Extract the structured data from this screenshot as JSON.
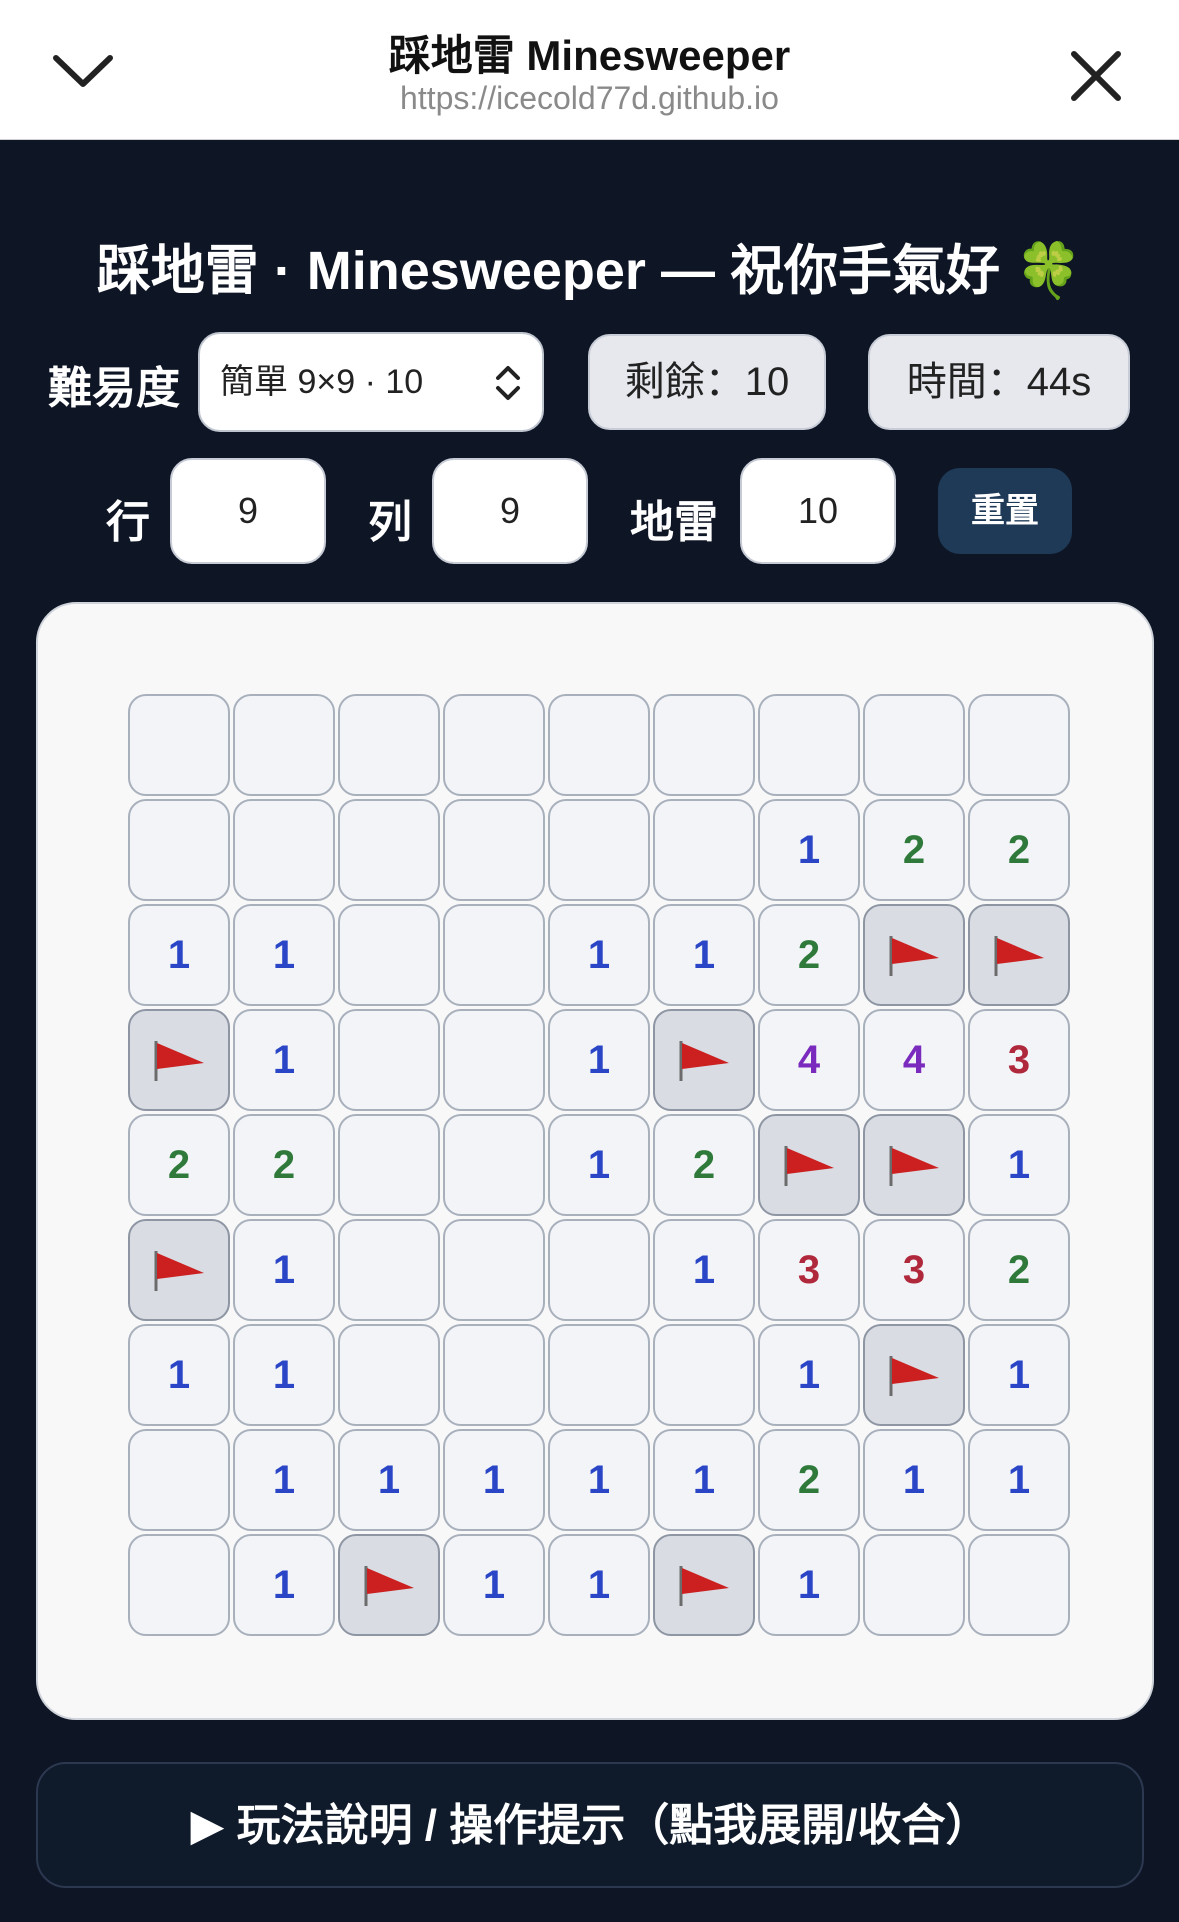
{
  "browser": {
    "title": "踩地雷 Minesweeper",
    "url": "https://icecold77d.github.io"
  },
  "game": {
    "title": "踩地雷 · Minesweeper — 祝你手氣好 🍀",
    "difficulty_label": "難易度",
    "difficulty_value": "簡單 9×9 · 10",
    "remaining": "剩餘：10",
    "time": "時間：44s",
    "rows_label": "行",
    "rows_value": "9",
    "cols_label": "列",
    "cols_value": "9",
    "mines_label": "地雷",
    "mines_value": "10",
    "reset_label": "重置",
    "help_label": "▶ 玩法說明 / 操作提示（點我展開/收合）"
  },
  "colors": {
    "1": "#2a46c7",
    "2": "#2f7a3a",
    "3": "#b0283c",
    "4": "#7a2bbd",
    "flag": "#cc1f1f"
  },
  "board": [
    [
      "",
      "",
      "",
      "",
      "",
      "",
      "",
      "",
      ""
    ],
    [
      "",
      "",
      "",
      "",
      "",
      "",
      "1",
      "2",
      "2"
    ],
    [
      "1",
      "1",
      "",
      "",
      "1",
      "1",
      "2",
      "F",
      "F"
    ],
    [
      "F",
      "1",
      "",
      "",
      "1",
      "F",
      "4",
      "4",
      "3"
    ],
    [
      "2",
      "2",
      "",
      "",
      "1",
      "2",
      "F",
      "F",
      "1"
    ],
    [
      "F",
      "1",
      "",
      "",
      "",
      "1",
      "3",
      "3",
      "2"
    ],
    [
      "1",
      "1",
      "",
      "",
      "",
      "",
      "1",
      "F",
      "1"
    ],
    [
      "",
      "1",
      "1",
      "1",
      "1",
      "1",
      "2",
      "1",
      "1"
    ],
    [
      "",
      "1",
      "F",
      "1",
      "1",
      "F",
      "1",
      "",
      ""
    ]
  ]
}
